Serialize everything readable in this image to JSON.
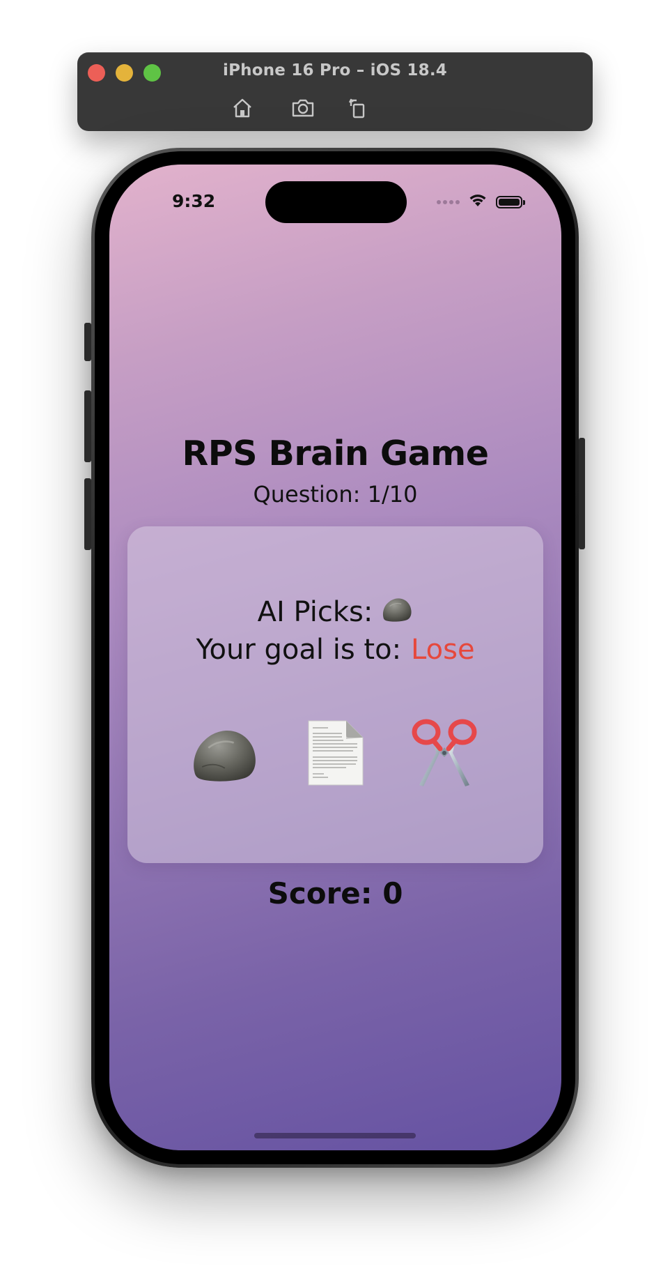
{
  "simulator": {
    "title": "iPhone 16 Pro – iOS 18.4",
    "toolbar_icons": [
      "home-icon",
      "screenshot-icon",
      "rotate-icon"
    ]
  },
  "status_bar": {
    "time": "9:32"
  },
  "game": {
    "title": "RPS Brain Game",
    "question": "Question: 1/10",
    "ai_picks_label": "AI Picks:",
    "ai_pick_icon": "rock-icon",
    "goal_label": "Your goal is to:",
    "goal_value": "Lose",
    "goal_color": "#e6483c",
    "choices": [
      "rock-icon",
      "paper-icon",
      "scissors-icon"
    ],
    "score": "Score: 0"
  },
  "colors": {
    "gradient_top": "#e2b2cc",
    "gradient_bottom": "#6552a2"
  }
}
